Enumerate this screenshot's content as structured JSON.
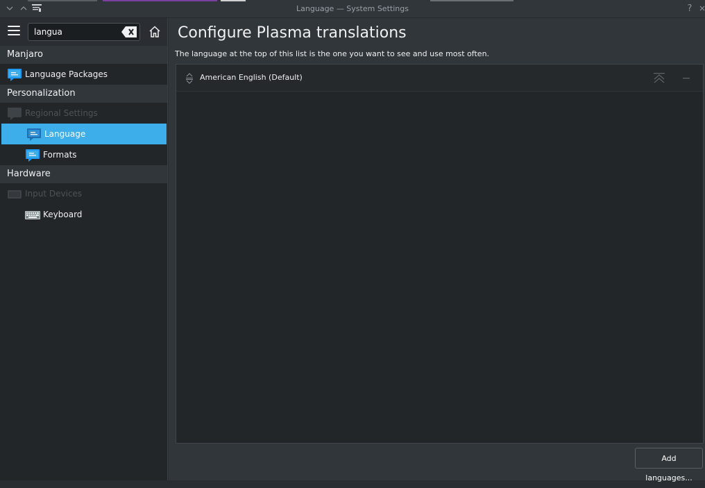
{
  "window": {
    "title": "Language — System Settings",
    "help_glyph": "?"
  },
  "sidebar": {
    "search_value": "langua",
    "groups": [
      {
        "label": "Manjaro",
        "items": [
          {
            "label": "Language Packages",
            "icon": "language-bubble-icon"
          }
        ]
      },
      {
        "label": "Personalization",
        "items": [
          {
            "label": "Regional Settings",
            "icon": "regional-settings-icon"
          },
          {
            "label": "Language",
            "icon": "language-bubble-icon"
          },
          {
            "label": "Formats",
            "icon": "language-bubble-icon"
          }
        ]
      },
      {
        "label": "Hardware",
        "items": [
          {
            "label": "Input Devices",
            "icon": "input-devices-icon"
          },
          {
            "label": "Keyboard",
            "icon": "keyboard-icon"
          }
        ]
      }
    ]
  },
  "main": {
    "title": "Configure Plasma translations",
    "description": "The language at the top of this list is the one you want to see and use most often.",
    "languages": [
      "American English (Default)"
    ],
    "add_button": "Add languages..."
  },
  "colors": {
    "accent": "#3daee9",
    "background": "#31363b",
    "sidebar": "#232629"
  }
}
